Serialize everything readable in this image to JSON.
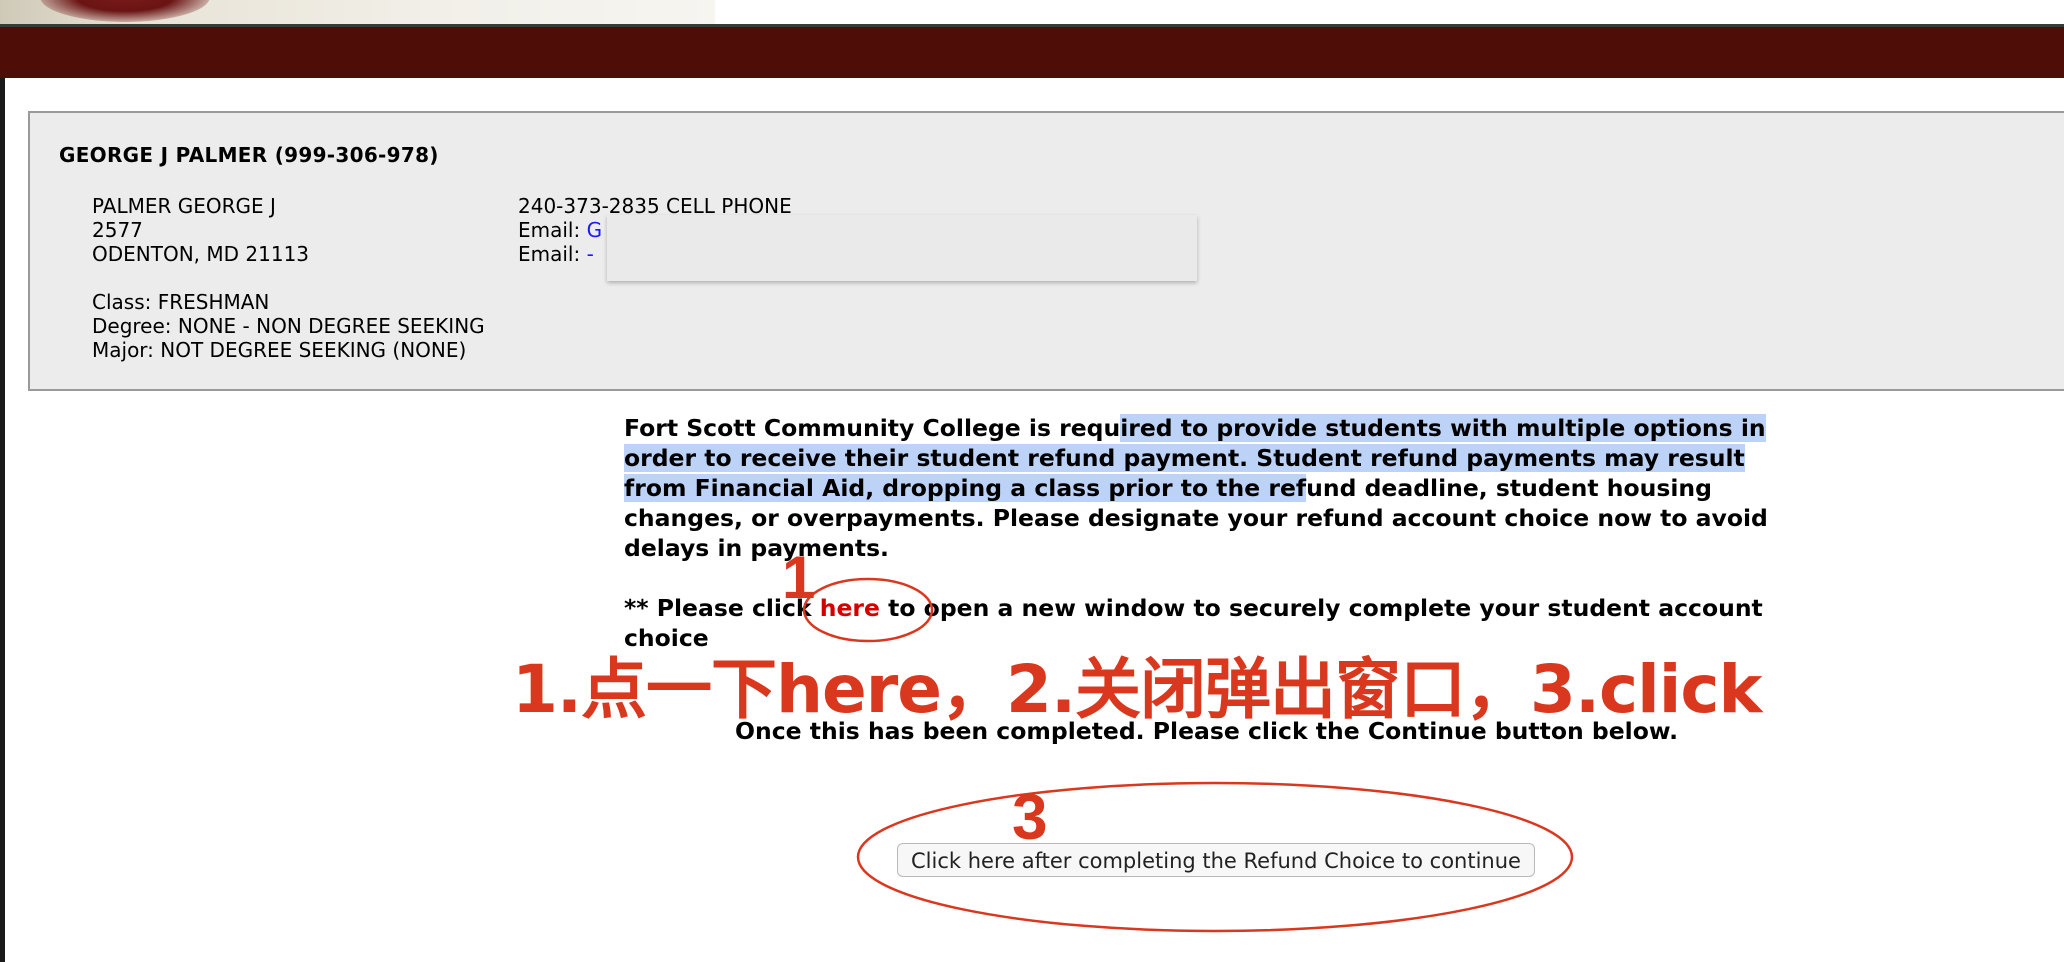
{
  "student": {
    "heading": "GEORGE J PALMER (999-306-978)",
    "name": "PALMER GEORGE J",
    "address_line1": "2577",
    "address_line2": "ODENTON, MD  21113",
    "class": "Class: FRESHMAN",
    "degree": "Degree: NONE - NON DEGREE SEEKING",
    "major": "Major: NOT DEGREE SEEKING (NONE)",
    "phone": "240-373-2835 CELL PHONE",
    "email_label_1": "Email: ",
    "email_value_1": "G",
    "email_label_2": "Email: ",
    "email_value_2": "-"
  },
  "notice": {
    "seg1": "Fort Scott Community College is requ",
    "seg2_highlight": "ired to provide students with multiple options in order to receive their student refund payment. Student refund payments may result from Financial Aid, dropping a class prior to the ref",
    "seg3": "und deadline, student housing changes, or overpayments. Please designate your refund account choice now to avoid delays in payments.",
    "click_prefix": "** Please click ",
    "here_link": "here",
    "click_suffix": " to open a new window to securely complete your student account choice",
    "once_completed": "Once this has been completed. Please click the Continue button below."
  },
  "continue_button": {
    "label": "Click here after completing the Refund Choice to continue"
  },
  "annotations": {
    "number_1": "1",
    "number_3": "3",
    "instruction": "1.点一下here，2.关闭弹出窗口，3.click",
    "color": "#d9381e"
  },
  "colors": {
    "header_bar": "#4e0e07",
    "panel_bg": "#ececec",
    "highlight": "#bcd3f7",
    "link_red": "#d40000",
    "email_link": "#1a1aff"
  }
}
